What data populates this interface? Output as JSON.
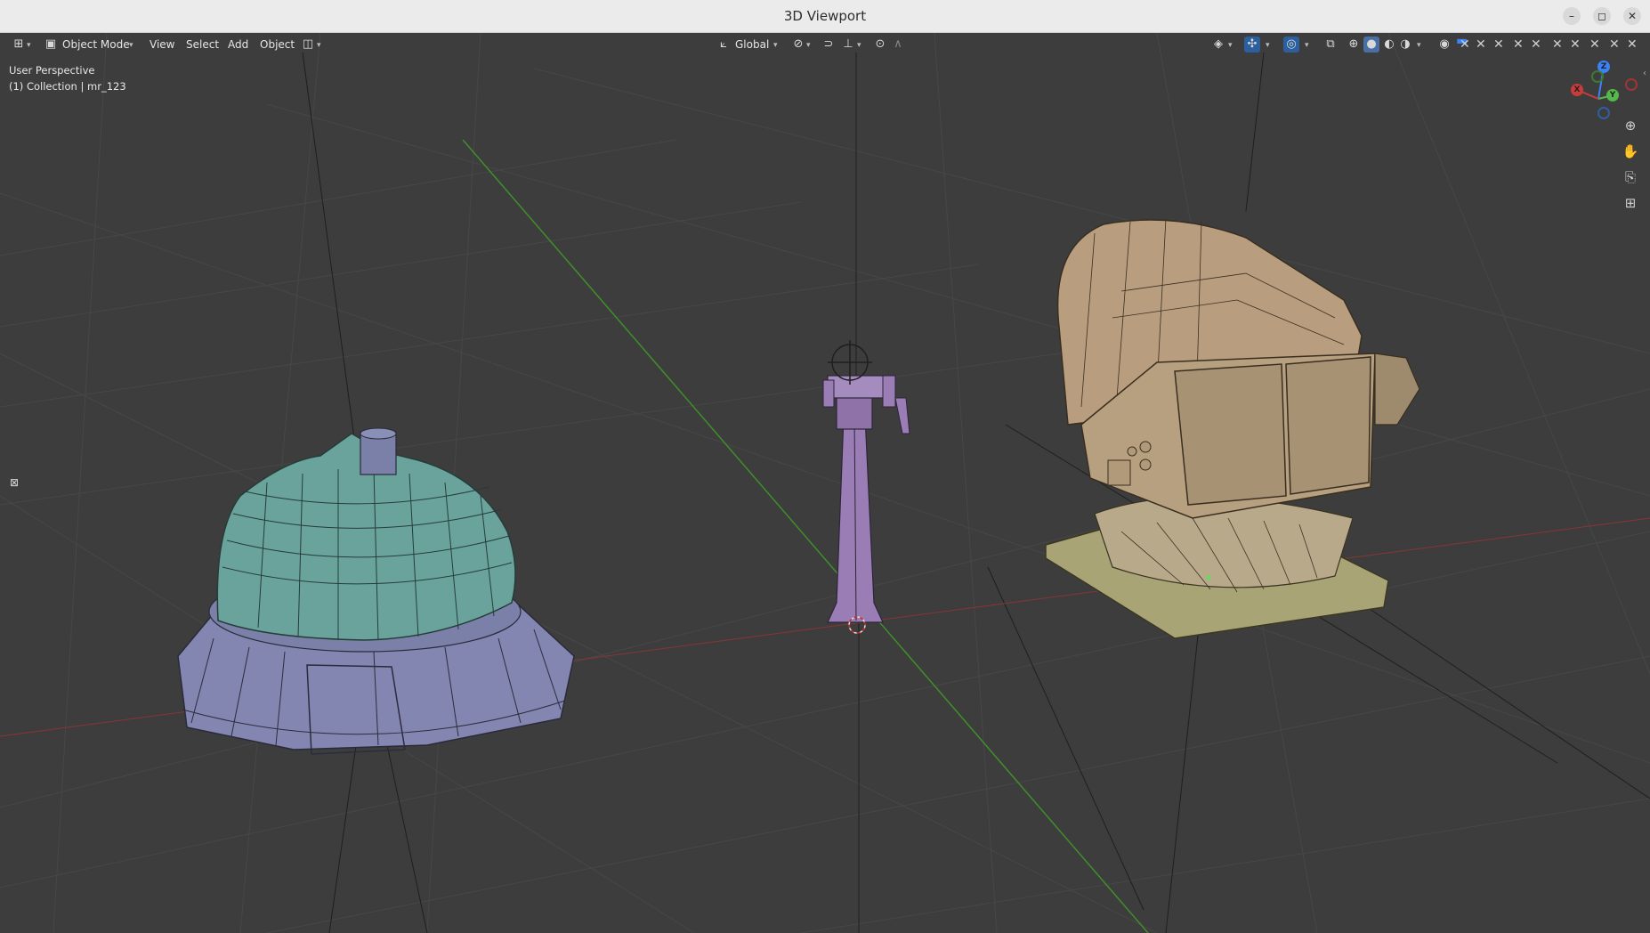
{
  "window": {
    "title": "3D Viewport",
    "minimize_glyph": "–",
    "maximize_glyph": "◻",
    "close_glyph": "✕"
  },
  "header": {
    "editor_type_icon": "editor-type-icon",
    "mode_label": "Object Mode",
    "menus": [
      "View",
      "Select",
      "Add",
      "Object"
    ],
    "transform_orientation": "Global",
    "icons": {
      "select_box": "select-box-icon",
      "orientation": "orientation-icon",
      "pivot": "pivot-icon",
      "snap": "snap-icon",
      "snap_target": "snap-target-icon",
      "proportional": "proportional-edit-icon",
      "falloff": "falloff-icon",
      "visibility": "visibility-icon",
      "gizmo": "gizmo-icon",
      "overlay": "overlay-icon",
      "xray": "xray-icon",
      "shading_wire": "shading-wireframe-icon",
      "shading_solid": "shading-solid-icon",
      "shading_material": "shading-material-icon",
      "shading_rendered": "shading-rendered-icon"
    }
  },
  "overlay": {
    "view_name": "User Perspective",
    "collection_info": "(1) Collection | mr_123"
  },
  "nav_gizmo": {
    "z": "Z",
    "y": "Y",
    "x": "X"
  },
  "colors": {
    "viewport_bg": "#3d3d3d",
    "grid": "#474747",
    "x_axis": "#9a3b3b",
    "y_axis": "#3f8f2a",
    "turret_dome": "#6aa39c",
    "turret_base": "#8286b0",
    "mast": "#9a7db4",
    "searchlight_body": "#b89e7e",
    "searchlight_base": "#a9a475"
  }
}
